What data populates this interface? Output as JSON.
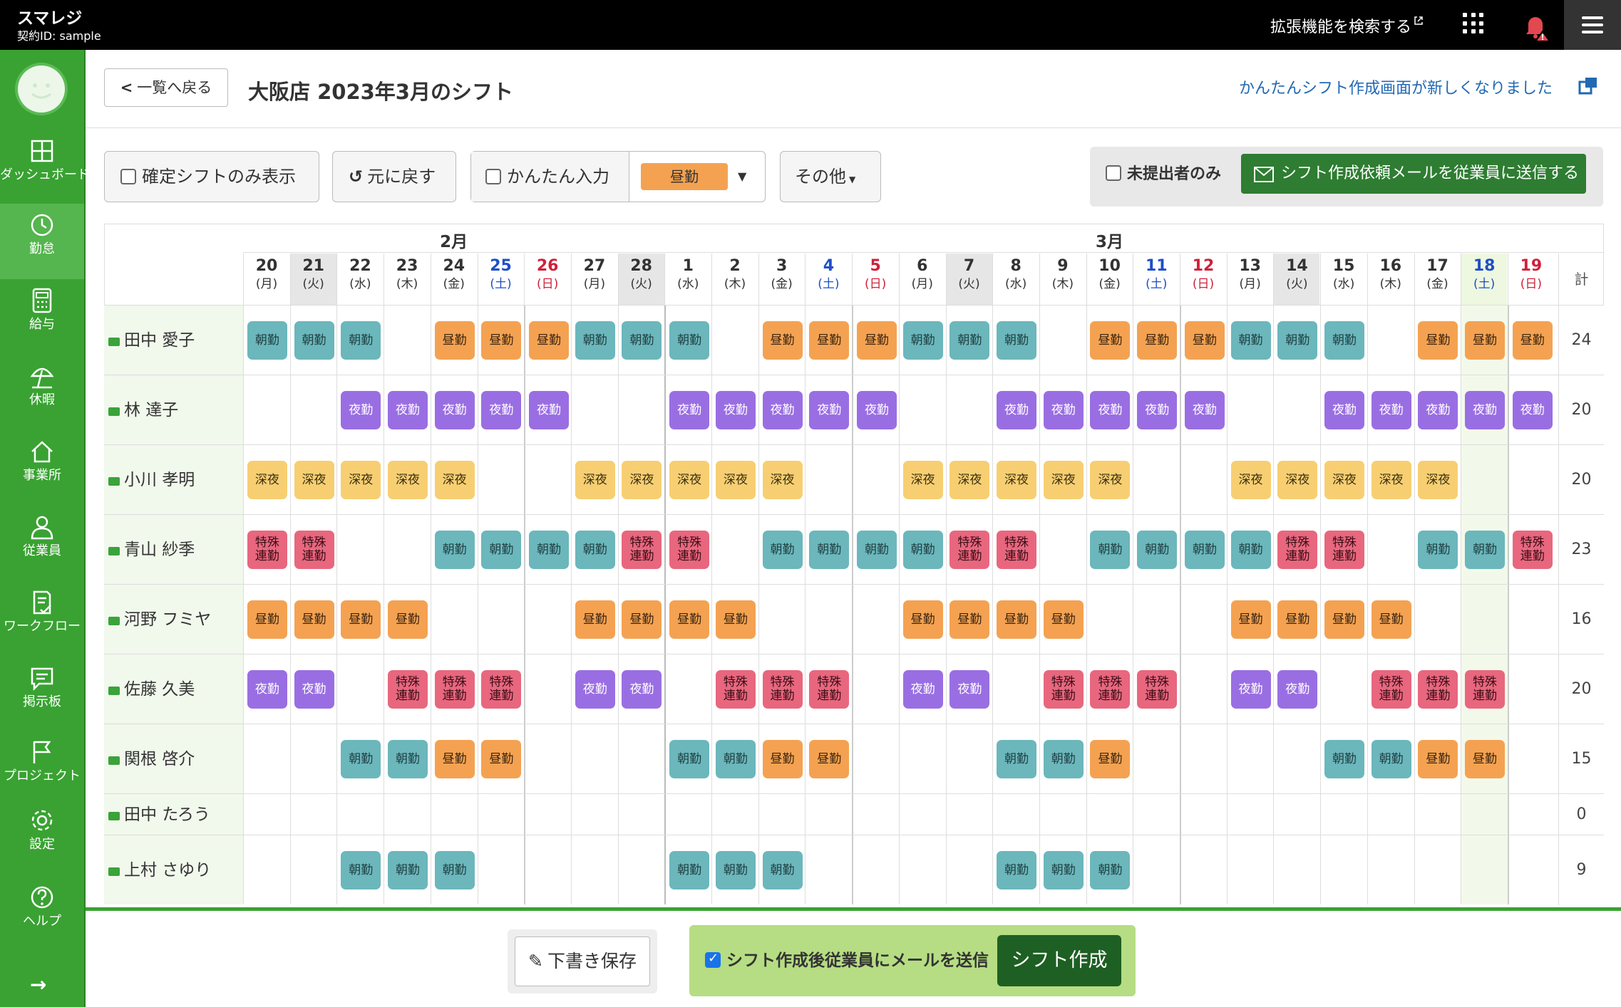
{
  "topbar": {
    "app_title": "スマレジ",
    "contract_id": "契約ID: sample",
    "ext_search": "拡張機能を検索する"
  },
  "sidebar": {
    "items": [
      {
        "label": "ダッシュボード",
        "icon": "dashboard-icon",
        "active": false
      },
      {
        "label": "勤怠",
        "icon": "clock-icon",
        "active": true
      },
      {
        "label": "給与",
        "icon": "calculator-icon",
        "active": false
      },
      {
        "label": "休暇",
        "icon": "parasol-icon",
        "active": false
      },
      {
        "label": "事業所",
        "icon": "home-icon",
        "active": false
      },
      {
        "label": "従業員",
        "icon": "user-icon",
        "active": false
      },
      {
        "label": "ワークフロー",
        "icon": "document-check-icon",
        "active": false
      },
      {
        "label": "掲示板",
        "icon": "chat-icon",
        "active": false
      },
      {
        "label": "プロジェクト",
        "icon": "flag-icon",
        "active": false
      },
      {
        "label": "設定",
        "icon": "gear-icon",
        "active": false
      },
      {
        "label": "ヘルプ",
        "icon": "help-icon",
        "active": false
      }
    ]
  },
  "header": {
    "back_label": "一覧へ戻る",
    "title": "大阪店 2023年3月のシフト",
    "new_screen_link": "かんたんシフト作成画面が新しくなりました"
  },
  "toolbar": {
    "confirmed_only": "確定シフトのみ表示",
    "undo": "元に戻す",
    "easy_input": "かんたん入力",
    "shift_type": "昼勤",
    "other": "その他",
    "unsubmitted_only": "未提出者のみ",
    "send_request": "シフト作成依頼メールを従業員に送信する"
  },
  "schedule": {
    "months": [
      "2月",
      "3月"
    ],
    "total_label": "計",
    "days": [
      {
        "d": "20",
        "w": "(月)",
        "t": ""
      },
      {
        "d": "21",
        "w": "(火)",
        "t": "g"
      },
      {
        "d": "22",
        "w": "(水)",
        "t": ""
      },
      {
        "d": "23",
        "w": "(木)",
        "t": ""
      },
      {
        "d": "24",
        "w": "(金)",
        "t": ""
      },
      {
        "d": "25",
        "w": "(土)",
        "t": "sat"
      },
      {
        "d": "26",
        "w": "(日)",
        "t": "sun"
      },
      {
        "d": "27",
        "w": "(月)",
        "t": ""
      },
      {
        "d": "28",
        "w": "(火)",
        "t": "g"
      },
      {
        "d": "1",
        "w": "(水)",
        "t": ""
      },
      {
        "d": "2",
        "w": "(木)",
        "t": ""
      },
      {
        "d": "3",
        "w": "(金)",
        "t": ""
      },
      {
        "d": "4",
        "w": "(土)",
        "t": "sat"
      },
      {
        "d": "5",
        "w": "(日)",
        "t": "sun"
      },
      {
        "d": "6",
        "w": "(月)",
        "t": ""
      },
      {
        "d": "7",
        "w": "(火)",
        "t": "g"
      },
      {
        "d": "8",
        "w": "(水)",
        "t": ""
      },
      {
        "d": "9",
        "w": "(木)",
        "t": ""
      },
      {
        "d": "10",
        "w": "(金)",
        "t": ""
      },
      {
        "d": "11",
        "w": "(土)",
        "t": "sat"
      },
      {
        "d": "12",
        "w": "(日)",
        "t": "sun"
      },
      {
        "d": "13",
        "w": "(月)",
        "t": ""
      },
      {
        "d": "14",
        "w": "(火)",
        "t": "g"
      },
      {
        "d": "15",
        "w": "(水)",
        "t": ""
      },
      {
        "d": "16",
        "w": "(木)",
        "t": ""
      },
      {
        "d": "17",
        "w": "(金)",
        "t": ""
      },
      {
        "d": "18",
        "w": "(土)",
        "t": "today"
      },
      {
        "d": "19",
        "w": "(日)",
        "t": "sun"
      }
    ],
    "shift_labels": {
      "A": "朝勤",
      "H": "昼勤",
      "Y": "夜勤",
      "S": "深夜",
      "T": "特殊\n連勤"
    },
    "employees": [
      {
        "name": "田中 愛子",
        "shifts": "AAA.HHHAAA.HHHAAA.HHHAAA.HHH",
        "total": "24"
      },
      {
        "name": "林 達子",
        "shifts": "..YYYYY..YYYYY..YYYYY..YYYYY",
        "total": "20"
      },
      {
        "name": "小川 孝明",
        "shifts": "SSSSS..SSSSS..SSSSS..SSSSS..",
        "total": "20"
      },
      {
        "name": "青山 紗季",
        "shifts": "TT..AAAATT.AAAATT.AAAATT.AAT",
        "total": "23"
      },
      {
        "name": "河野 フミヤ",
        "shifts": "HHHH...HHHH...HHHH...HHHH...",
        "total": "16"
      },
      {
        "name": "佐藤 久美",
        "shifts": "YY.TTT.YY.TTT.YY.TTT.YY.TTT.",
        "total": "20"
      },
      {
        "name": "関根 啓介",
        "shifts": "..AAHH...AAHH...AAH....AAHH.",
        "total": "15"
      },
      {
        "name": "田中 たろう",
        "shifts": "............................",
        "total": "0"
      },
      {
        "name": "上村 さゆり",
        "shifts": "..AAA....AAA....AAA.........",
        "total": "9"
      }
    ]
  },
  "bottom": {
    "draft_save": "下書き保存",
    "send_mail_after": "シフト作成後従業員にメールを送信",
    "create": "シフト作成"
  },
  "colors": {
    "brand_green": "#39a232",
    "morning": "#6bb7bc",
    "day": "#f4a251",
    "night": "#9a6ee3",
    "late": "#f7cf72",
    "special": "#e8677e",
    "saturday": "#1e4fc8",
    "sunday": "#d0213a"
  }
}
